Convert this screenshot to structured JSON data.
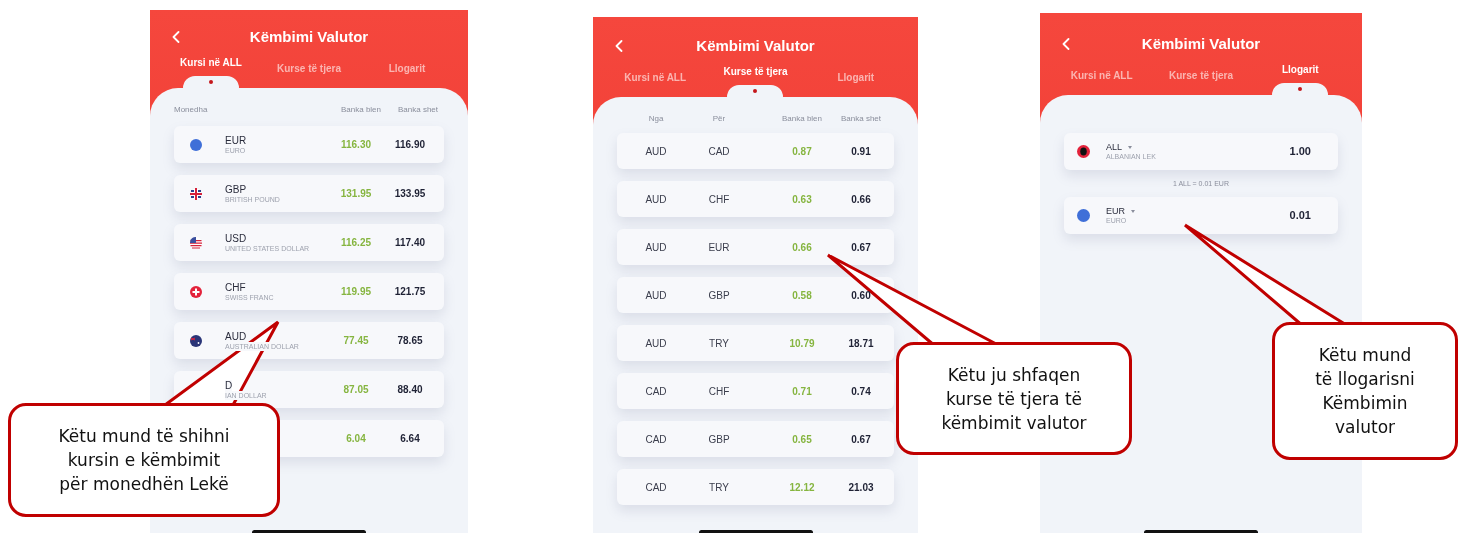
{
  "screens": [
    {
      "kind": "currency_list",
      "title": "Këmbimi Valutor",
      "tabs": [
        {
          "label": "Kursi në ALL",
          "selected": true
        },
        {
          "label": "Kurse të tjera",
          "selected": false
        },
        {
          "label": "Llogarit",
          "selected": false
        }
      ],
      "columns": [
        "Monedha",
        "Banka blen",
        "Banka shet"
      ],
      "rows": [
        {
          "flag": {
            "kind": "eu"
          },
          "code": "EUR",
          "name": "EURO",
          "buy": "116.30",
          "sell": "116.90"
        },
        {
          "flag": {
            "kind": "gb"
          },
          "code": "GBP",
          "name": "BRITISH POUND",
          "buy": "131.95",
          "sell": "133.95"
        },
        {
          "flag": {
            "kind": "us"
          },
          "code": "USD",
          "name": "UNITED STATES DOLLAR",
          "buy": "116.25",
          "sell": "117.40"
        },
        {
          "flag": {
            "kind": "ch"
          },
          "code": "CHF",
          "name": "SWISS FRANC",
          "buy": "119.95",
          "sell": "121.75"
        },
        {
          "flag": {
            "kind": "au"
          },
          "code": "AUD",
          "name": "AUSTRALIAN DOLLAR",
          "buy": "77.45",
          "sell": "78.65"
        },
        {
          "code": "D",
          "name": "IAN DOLLAR",
          "buy": "87.05",
          "sell": "88.40"
        },
        {
          "buy": "6.04",
          "sell": "6.64"
        }
      ]
    },
    {
      "kind": "pair_list",
      "title": "Këmbimi Valutor",
      "tabs": [
        {
          "label": "Kursi në ALL",
          "selected": false
        },
        {
          "label": "Kurse të tjera",
          "selected": true
        },
        {
          "label": "Llogarit",
          "selected": false
        }
      ],
      "columns": [
        "Nga",
        "Për",
        "Banka blen",
        "Banka shet"
      ],
      "rows": [
        {
          "from": "AUD",
          "to": "CAD",
          "buy": "0.87",
          "sell": "0.91"
        },
        {
          "from": "AUD",
          "to": "CHF",
          "buy": "0.63",
          "sell": "0.66"
        },
        {
          "from": "AUD",
          "to": "EUR",
          "buy": "0.66",
          "sell": "0.67"
        },
        {
          "from": "AUD",
          "to": "GBP",
          "buy": "0.58",
          "sell": "0.60"
        },
        {
          "from": "AUD",
          "to": "TRY",
          "buy": "10.79",
          "sell": "18.71"
        },
        {
          "from": "CAD",
          "to": "CHF",
          "buy": "0.71",
          "sell": "0.74"
        },
        {
          "from": "CAD",
          "to": "GBP",
          "buy": "0.65",
          "sell": "0.67"
        },
        {
          "from": "CAD",
          "to": "TRY",
          "buy": "12.12",
          "sell": "21.03"
        }
      ]
    },
    {
      "kind": "converter",
      "title": "Këmbimi Valutor",
      "tabs": [
        {
          "label": "Kursi në ALL",
          "selected": false
        },
        {
          "label": "Kurse të tjera",
          "selected": false
        },
        {
          "label": "Llogarit",
          "selected": true
        }
      ],
      "from": {
        "flag": {
          "kind": "al"
        },
        "code": "ALL",
        "name": "ALBANIAN LEK",
        "amount": "1.00"
      },
      "rate": "1 ALL = 0.01 EUR",
      "to": {
        "flag": {
          "kind": "eu"
        },
        "code": "EUR",
        "name": "EURO",
        "amount": "0.01"
      }
    }
  ],
  "callouts": [
    {
      "lines": [
        "Këtu mund të shihni",
        "kursin e këmbimit",
        "për monedhën Lekë"
      ]
    },
    {
      "lines": [
        "Këtu ju shfaqen",
        "kurse të tjera të",
        "këmbimit valutor"
      ]
    },
    {
      "lines": [
        "Këtu mund",
        "të llogarisni",
        "Këmbimin",
        "valutor"
      ]
    }
  ]
}
